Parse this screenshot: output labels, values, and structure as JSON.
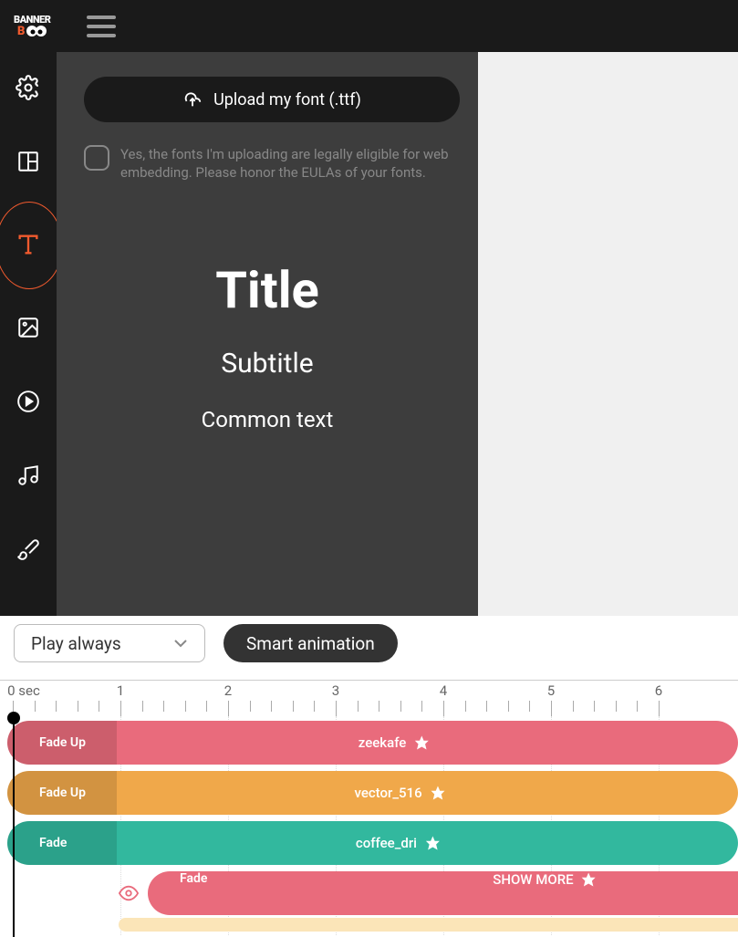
{
  "logo": {
    "line1": "BANNER",
    "line2": "B"
  },
  "upload": {
    "label": "Upload my font (.ttf)"
  },
  "consent": {
    "text": "Yes, the fonts I'm uploading are legally eligible for web embedding. Please honor the EULAs of your fonts."
  },
  "samples": {
    "title": "Title",
    "subtitle": "Subtitle",
    "common": "Common text"
  },
  "playSelect": {
    "label": "Play always"
  },
  "smartBtn": {
    "label": "Smart animation"
  },
  "timeline": {
    "labels": [
      "0 sec",
      "1",
      "2",
      "3",
      "4",
      "5",
      "6"
    ],
    "tracks": [
      {
        "effect": "Fade Up",
        "name": "zeekafe",
        "color": "red",
        "darkenPct": 16
      },
      {
        "effect": "Fade Up",
        "name": "vector_516",
        "color": "orange",
        "darkenPct": 16
      },
      {
        "effect": "Fade",
        "name": "coffee_dri",
        "color": "teal",
        "darkenPct": 16
      },
      {
        "effect": "Fade",
        "name": "SHOW MORE",
        "color": "red",
        "darkenPct": 0,
        "indent": true
      }
    ]
  }
}
